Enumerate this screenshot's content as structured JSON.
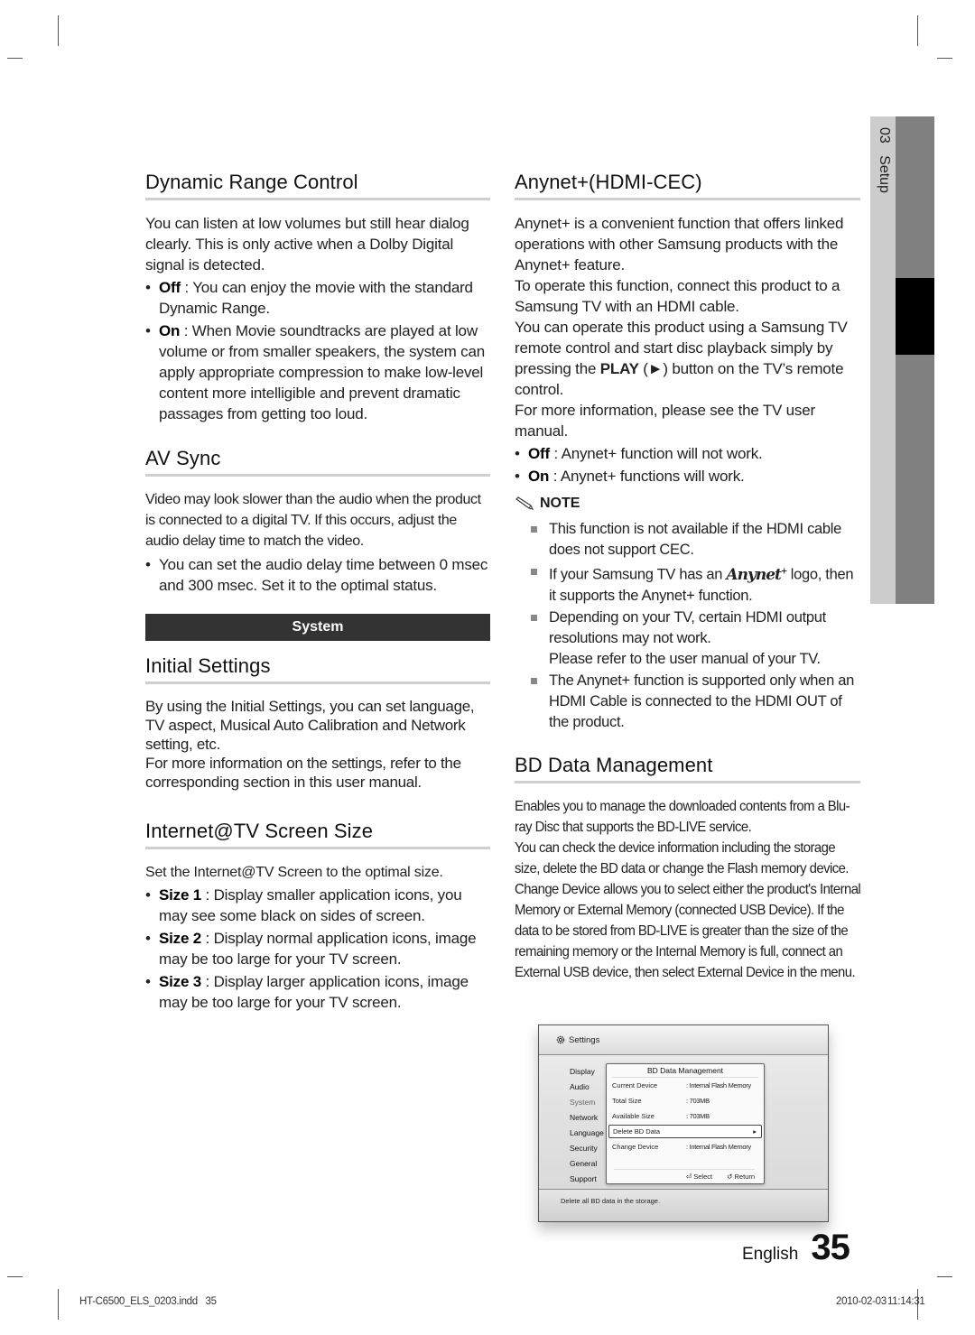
{
  "side_tab": {
    "chapter": "03",
    "label": "Setup"
  },
  "left_column": {
    "dynamic_range": {
      "title": "Dynamic Range Control",
      "intro": "You can listen at low volumes but still hear dialog clearly. This is only active when a Dolby Digital signal is detected.",
      "items": [
        {
          "term": "Off",
          "text": " : You can enjoy the movie with the standard Dynamic Range."
        },
        {
          "term": "On",
          "text": " : When Movie soundtracks are played at low volume or from smaller speakers, the system can apply appropriate compression to make low-level content more intelligible and prevent dramatic passages from getting too loud."
        }
      ]
    },
    "av_sync": {
      "title": "AV Sync",
      "intro": "Video may look slower than the audio when the product is connected to a digital TV. If this occurs, adjust the audio delay time to match the video.",
      "items": [
        {
          "text": "You can set the audio delay time between 0 msec and 300 msec. Set it to the optimal status."
        }
      ]
    },
    "band_label": "System",
    "initial_settings": {
      "title": "Initial Settings",
      "para1": "By using the Initial Settings, you can set language, TV aspect, Musical Auto Calibration and Network setting, etc.",
      "para2": "For more information on the settings, refer to the corresponding section in this user manual."
    },
    "internet_tv": {
      "title": "Internet@TV Screen Size",
      "intro": "Set the Internet@TV Screen to the optimal size.",
      "items": [
        {
          "term": "Size 1",
          "text": " : Display smaller application icons, you may see some black on sides of screen."
        },
        {
          "term": "Size 2",
          "text": " : Display normal application icons, image may be too large for your TV screen."
        },
        {
          "term": "Size 3",
          "text": " : Display larger application icons, image may be too large for your TV screen."
        }
      ]
    }
  },
  "right_column": {
    "anynet": {
      "title": "Anynet+(HDMI-CEC)",
      "para1": "Anynet+ is a convenient function that offers linked operations with other Samsung products with the Anynet+ feature.",
      "para2": "To operate this function, connect this product to a Samsung TV with an HDMI cable.",
      "para3_pre": "You can operate this product using a Samsung TV remote control and start disc playback simply by pressing the ",
      "para3_bold": "PLAY",
      "para3_post": " (►) button on the TV’s remote control.",
      "para4": "For more information, please see the TV user manual.",
      "items": [
        {
          "term": "Off",
          "text": " : Anynet+ function will not work."
        },
        {
          "term": "On",
          "text": " : Anynet+ functions will work."
        }
      ],
      "note_label": "NOTE",
      "notes": [
        "This function is not available if the HDMI cable does not support CEC.",
        {
          "pre": "If your Samsung TV has an ",
          "logo": "Anynet",
          "logo_sup": "+",
          "post": " logo, then it supports the Anynet+ function."
        },
        "Depending on your TV, certain HDMI output resolutions may not work.",
        "The Anynet+ function is supported only when an HDMI Cable is connected to the HDMI OUT of the product."
      ],
      "note3_extra": "Please refer to the user manual of your TV."
    },
    "bd_data": {
      "title": "BD Data Management",
      "para1": "Enables you to manage the downloaded contents from a Blu-ray Disc that supports the BD-LIVE service.",
      "para2": "You can check the device information including the storage size, delete the BD data or change the Flash memory device. Change Device allows you to select either the product's Internal Memory or External Memory (connected USB Device). If the data to be stored from BD-LIVE is greater than the size of the remaining memory or the Internal Memory is full, connect an External USB device, then select External Device in the menu."
    }
  },
  "tv_screen": {
    "header": "Settings",
    "menu": [
      "Display",
      "Audio",
      "System",
      "Network",
      "Language",
      "Security",
      "General",
      "Support"
    ],
    "active_menu": "System",
    "popup": {
      "title": "BD Data Management",
      "rows": [
        {
          "key": "Current Device",
          "value": ": Internal Flash Memory"
        },
        {
          "key": "Total Size",
          "value": ": 703MB"
        },
        {
          "key": "Available Size",
          "value": ": 703MB"
        }
      ],
      "selected_item": "Delete BD Data",
      "row_after": {
        "key": "Change Device",
        "value": ": Internal Flash Memory"
      },
      "select_label": "Select",
      "return_label": "Return"
    },
    "status": "Delete all BD data in the storage."
  },
  "footer": {
    "language": "English",
    "page_number": "35",
    "slug_left": "HT-C6500_ELS_0203.indd   35",
    "slug_date": "2010-02-03",
    "slug_time": "11:14:31"
  }
}
